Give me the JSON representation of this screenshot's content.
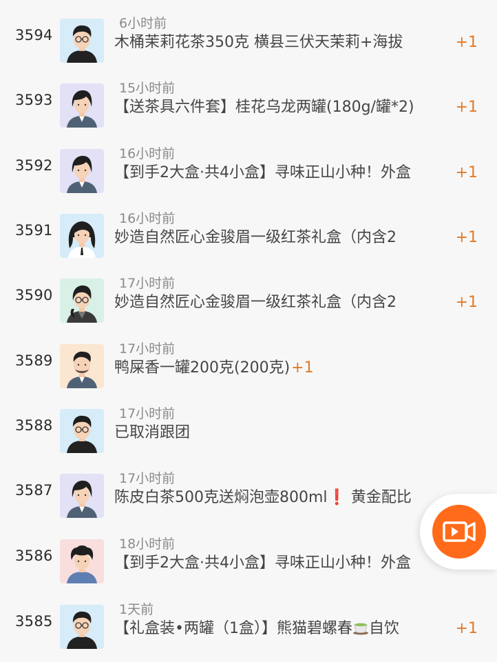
{
  "orders": [
    {
      "number": "3594",
      "time": "6小时前",
      "desc": "木桶茉莉花茶350克 横县三伏天茉莉+海拔",
      "plus": "+1",
      "avatar": "male-glasses-blue"
    },
    {
      "number": "3593",
      "time": "15小时前",
      "desc": "【送茶具六件套】桂花乌龙两罐(180g/罐*2)",
      "plus": "+1",
      "avatar": "female-purple"
    },
    {
      "number": "3592",
      "time": "16小时前",
      "desc": "【到手2大盒·共4小盒】寻味正山小种！外盒",
      "plus": "+1",
      "avatar": "female-purple"
    },
    {
      "number": "3591",
      "time": "16小时前",
      "desc": "妙造自然匠心金骏眉一级红茶礼盒（内含2",
      "plus": "+1",
      "avatar": "female-longhair-blue"
    },
    {
      "number": "3590",
      "time": "17小时前",
      "desc": "妙造自然匠心金骏眉一级红茶礼盒（内含2",
      "plus": "+1",
      "avatar": "female-glasses-green"
    },
    {
      "number": "3589",
      "time": "17小时前",
      "desc": "鸭屎香一罐200克(200克)",
      "plus": "+1",
      "avatar": "male-beard-orange"
    },
    {
      "number": "3588",
      "time": "17小时前",
      "desc": "已取消跟团",
      "plus": "",
      "avatar": "male-glasses-blue"
    },
    {
      "number": "3587",
      "time": "17小时前",
      "desc": "陈皮白茶500克送焖泡壶800ml",
      "desc_bang": "❗",
      "desc_tail": " 黄金配比",
      "plus": "",
      "avatar": "female-purple"
    },
    {
      "number": "3586",
      "time": "18小时前",
      "desc": "【到手2大盒·共4小盒】寻味正山小种！外盒",
      "plus": "+1",
      "avatar": "male-curly-pink"
    },
    {
      "number": "3585",
      "time": "1天前",
      "desc": "【礼盒装•两罐（1盒）】熊猫碧螺春",
      "desc_tail": "自饮",
      "plus": "+1",
      "avatar": "male-glasses-blue"
    }
  ],
  "video_button": {
    "icon": "video-camera-icon"
  },
  "colors": {
    "accent_orange": "#e07a28",
    "video_orange": "#ff6b1a",
    "warning_red": "#d9281f",
    "background": "#f7f7f7"
  }
}
